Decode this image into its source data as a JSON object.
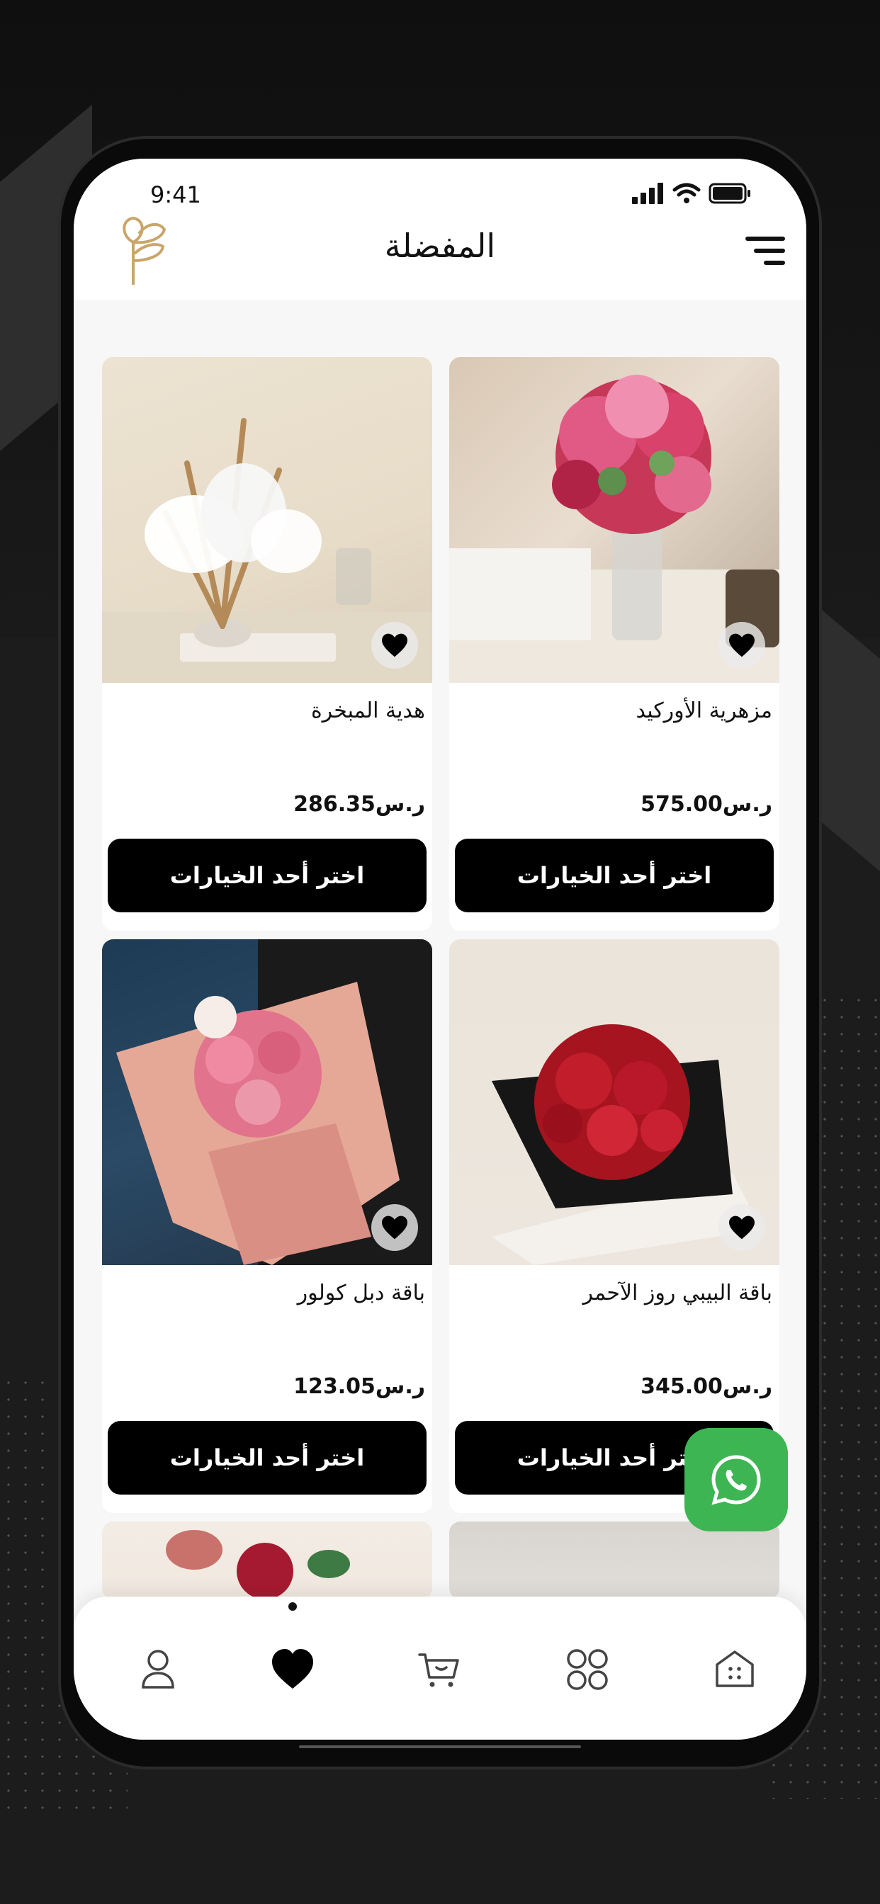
{
  "status": {
    "time": "9:41"
  },
  "header": {
    "title": "المفضلة"
  },
  "products": [
    {
      "name": "مزهرية الأوركيد",
      "price": "575.00ر.س",
      "button": "اختر أحد الخيارات"
    },
    {
      "name": "هدية المبخرة",
      "price": "286.35ر.س",
      "button": "اختر أحد الخيارات"
    },
    {
      "name": "باقة البيبي روز الآحمر",
      "price": "345.00ر.س",
      "button": "اختر أحد الخيارات"
    },
    {
      "name": "باقة دبل كولور",
      "price": "123.05ر.س",
      "button": "اختر أحد الخيارات"
    }
  ],
  "nav": {
    "items": [
      "home-icon",
      "categories-icon",
      "cart-icon",
      "favorites-icon",
      "profile-icon"
    ],
    "active": "favorites-icon"
  },
  "colors": {
    "accent": "#000000",
    "whatsapp": "#3eb553",
    "logo": "#c9a56a"
  }
}
